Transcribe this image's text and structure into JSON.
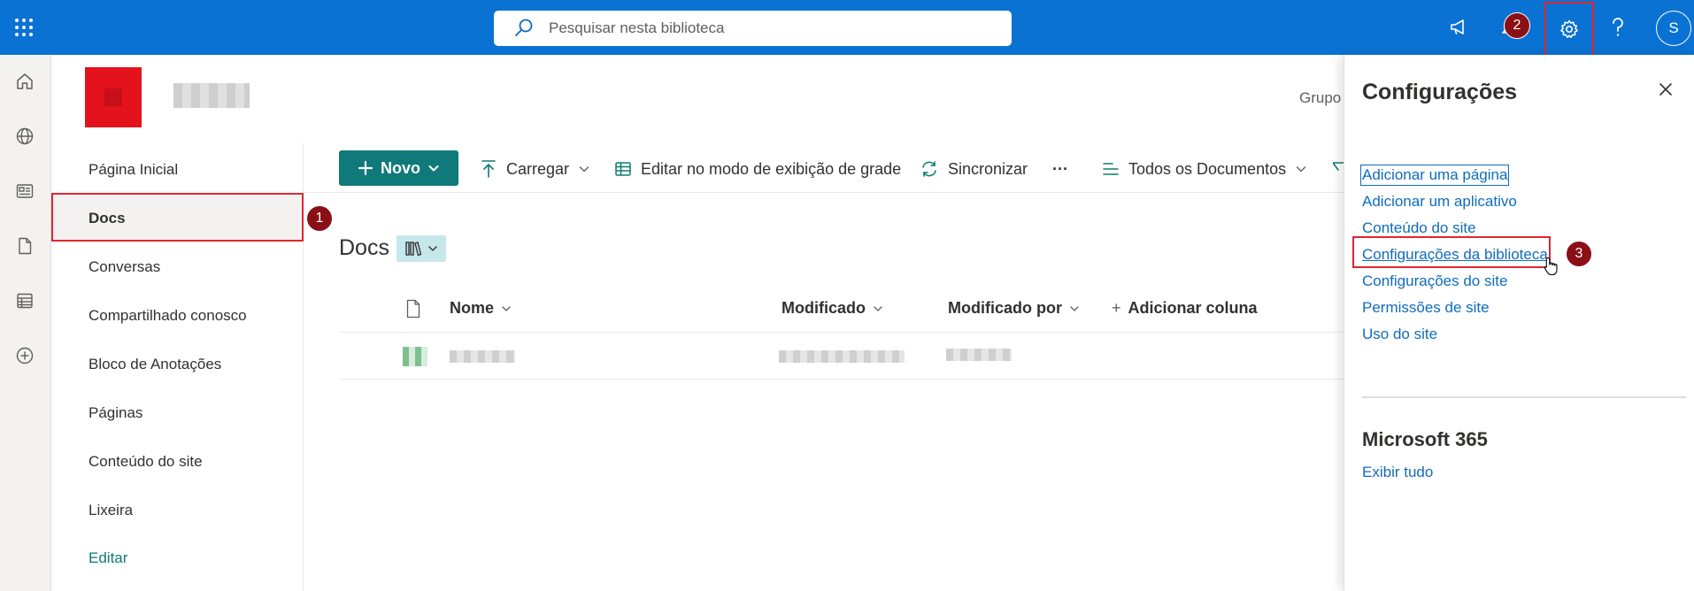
{
  "topbar": {
    "search_placeholder": "Pesquisar nesta biblioteca",
    "avatar_initial": "S",
    "accent_color": "#0a72d3"
  },
  "annotations": [
    "1",
    "2",
    "3"
  ],
  "site": {
    "group_label": "Grupo"
  },
  "leftnav": {
    "items": [
      {
        "label": "Página Inicial"
      },
      {
        "label": "Docs"
      },
      {
        "label": "Conversas"
      },
      {
        "label": "Compartilhado conosco"
      },
      {
        "label": "Bloco de Anotações"
      },
      {
        "label": "Páginas"
      },
      {
        "label": "Conteúdo do site"
      },
      {
        "label": "Lixeira"
      }
    ],
    "edit_label": "Editar"
  },
  "commandbar": {
    "new_label": "Novo",
    "upload_label": "Carregar",
    "grid_edit_label": "Editar no modo de exibição de grade",
    "sync_label": "Sincronizar",
    "more_label": "···",
    "view_label": "Todos os Documentos"
  },
  "library": {
    "title": "Docs",
    "columns": {
      "name": "Nome",
      "modified": "Modificado",
      "modified_by": "Modificado por",
      "add_column": "Adicionar coluna"
    }
  },
  "settings_panel": {
    "title": "Configurações",
    "links": [
      {
        "label": "Adicionar uma página"
      },
      {
        "label": "Adicionar um aplicativo"
      },
      {
        "label": "Conteúdo do site"
      },
      {
        "label": "Configurações da biblioteca"
      },
      {
        "label": "Configurações do site"
      },
      {
        "label": "Permissões de site"
      },
      {
        "label": "Uso do site"
      }
    ],
    "m365_title": "Microsoft 365",
    "m365_link": "Exibir tudo"
  }
}
